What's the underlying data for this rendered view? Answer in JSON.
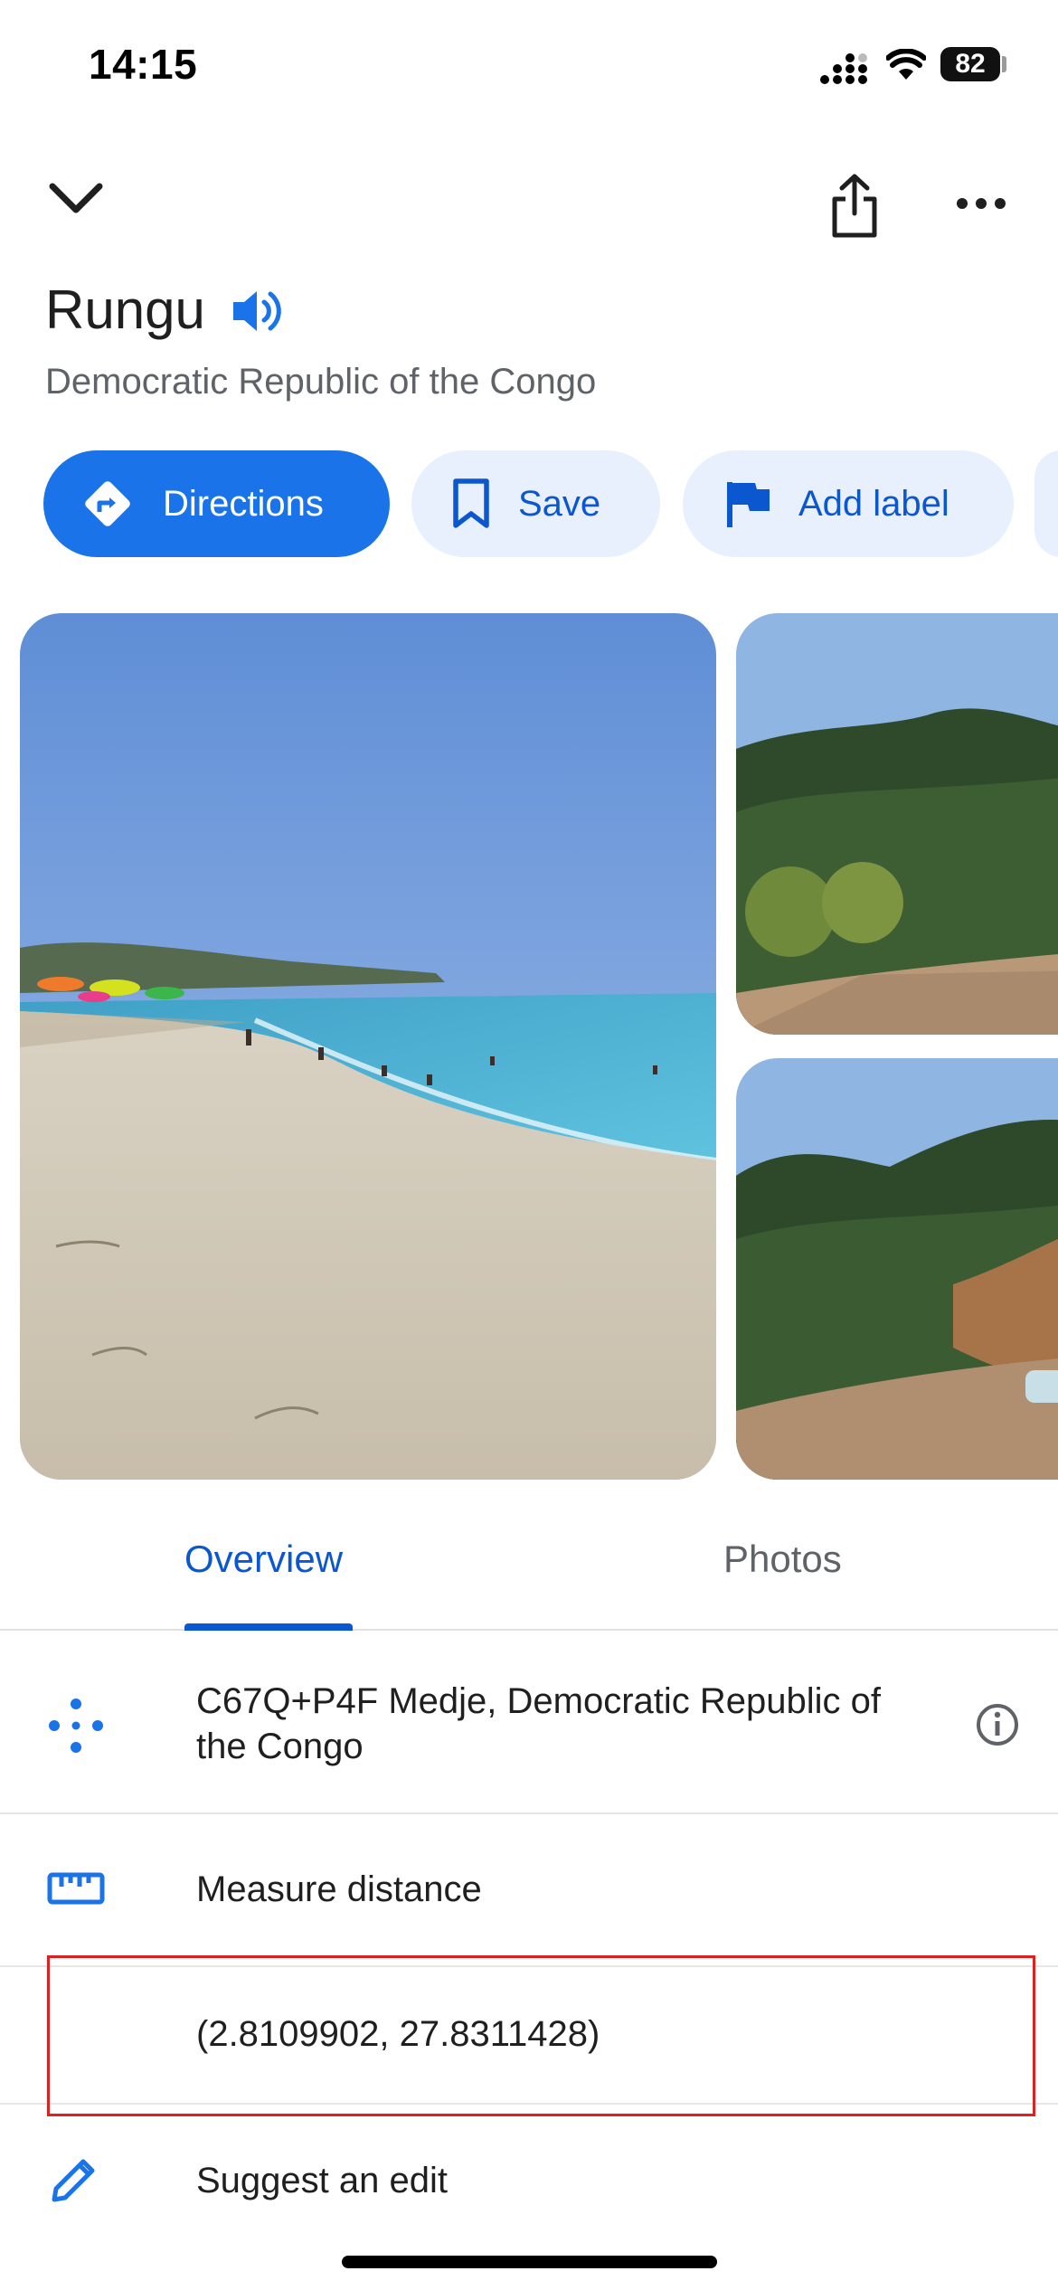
{
  "status_bar": {
    "time": "14:15",
    "battery": "82"
  },
  "toolbar": {
    "collapse_icon": "chevron-down-icon",
    "share_icon": "share-icon",
    "more_icon": "more-horiz-icon"
  },
  "place": {
    "name": "Rungu",
    "country": "Democratic Republic of the Congo",
    "speaker_icon": "volume-icon"
  },
  "actions": [
    {
      "label": "Directions",
      "icon": "directions-icon"
    },
    {
      "label": "Save",
      "icon": "bookmark-icon"
    },
    {
      "label": "Add label",
      "icon": "flag-icon"
    }
  ],
  "tabs": [
    {
      "label": "Overview",
      "selected": true
    },
    {
      "label": "Photos",
      "selected": false
    }
  ],
  "details": {
    "plus_code_line1": "C67Q+P4F Medje, Democratic Republic of",
    "plus_code_line2": "the Congo",
    "measure_distance": "Measure distance",
    "coordinates": "(2.8109902, 27.8311428)",
    "suggest_edit": "Suggest an edit"
  },
  "colors": {
    "accent": "#1a73e8",
    "chip_bg": "#e8f0fe",
    "chip_text": "#0b57d0",
    "highlight": "#e02020"
  }
}
